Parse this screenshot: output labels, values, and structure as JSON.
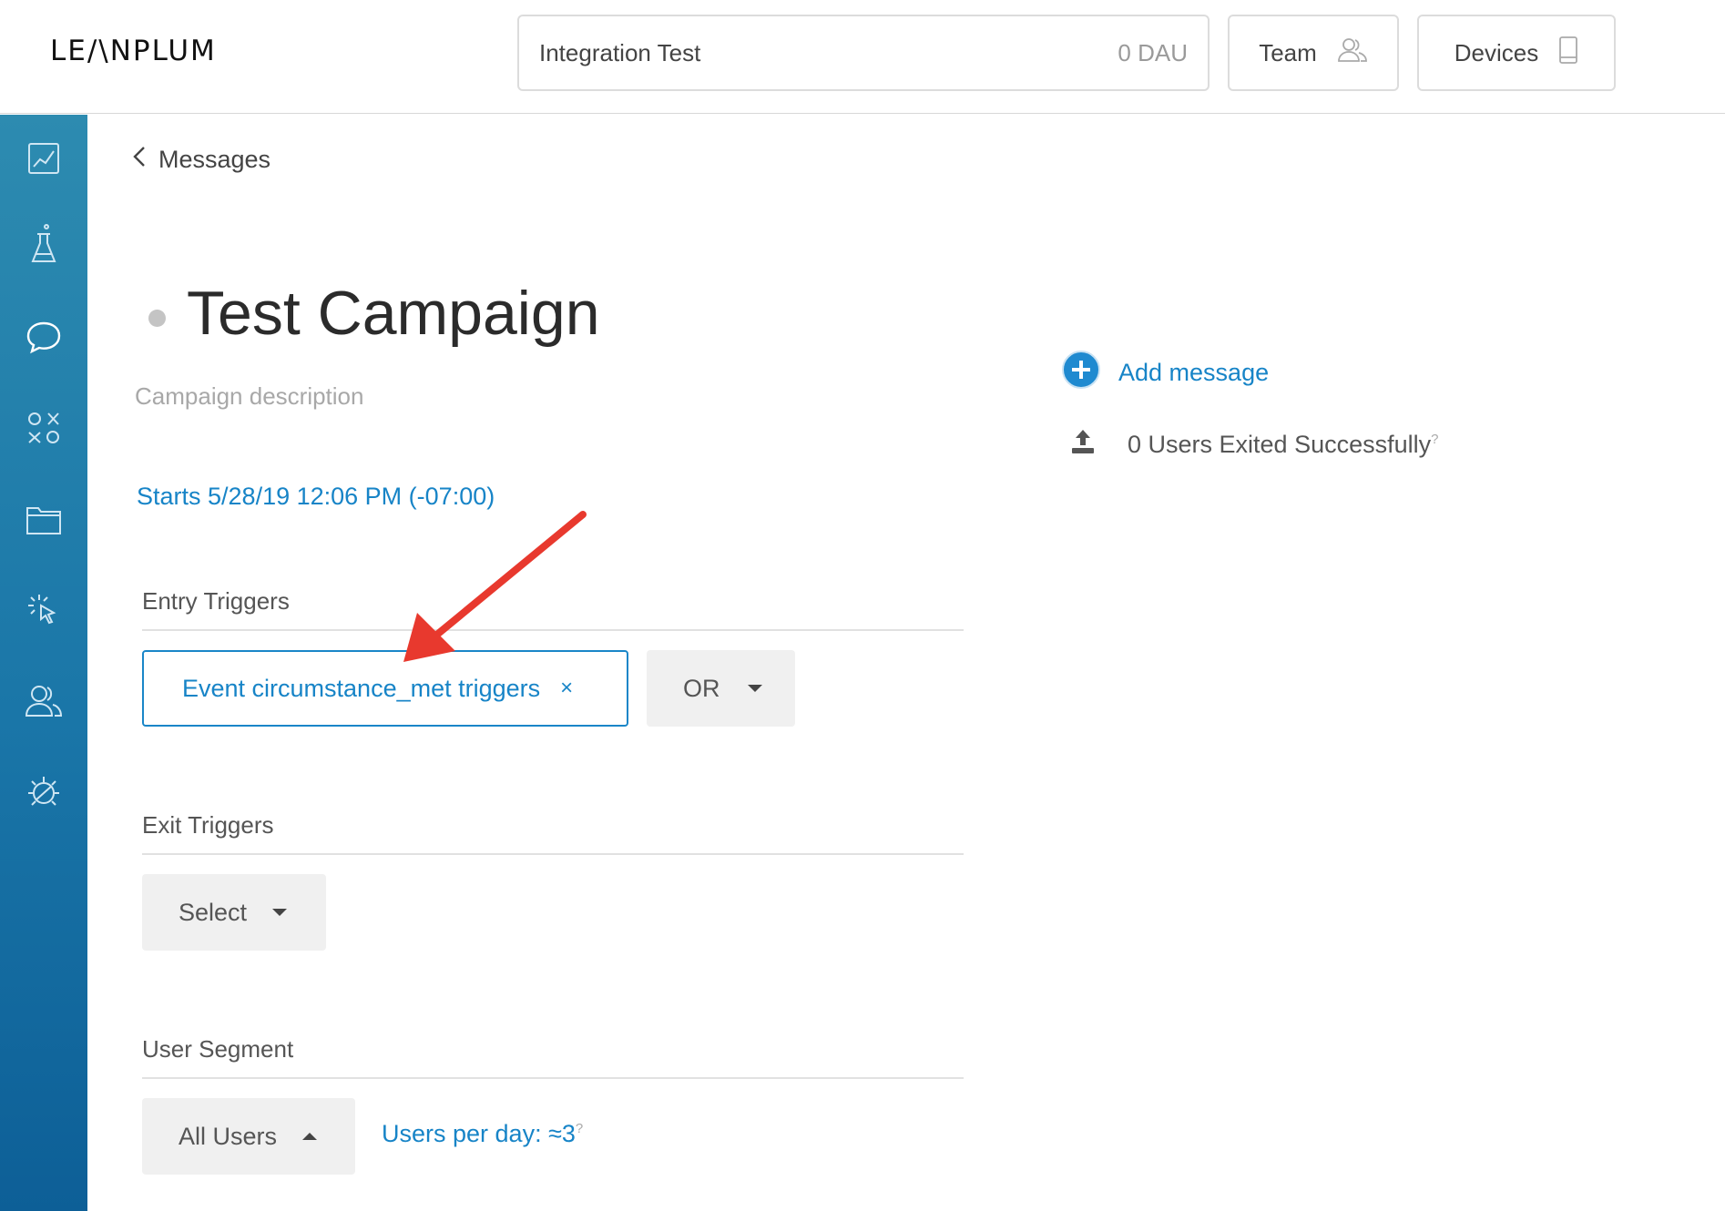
{
  "header": {
    "logo_text": "LE/\\NPLUM",
    "app_name": "Integration Test",
    "dau": "0 DAU",
    "team_label": "Team",
    "devices_label": "Devices"
  },
  "sidebar": {
    "items": [
      {
        "icon": "analytics-icon"
      },
      {
        "icon": "ab-test-flask-icon"
      },
      {
        "icon": "messages-chat-icon"
      },
      {
        "icon": "variables-icon"
      },
      {
        "icon": "folder-icon"
      },
      {
        "icon": "click-cursor-icon"
      },
      {
        "icon": "users-icon"
      },
      {
        "icon": "debug-bug-icon"
      }
    ],
    "accent": "#1a76a8"
  },
  "nav": {
    "back_label": "Messages"
  },
  "campaign": {
    "title": "Test Campaign",
    "description_placeholder": "Campaign description",
    "starts": "Starts 5/28/19 12:06 PM (-07:00)"
  },
  "entry_triggers": {
    "label": "Entry Triggers",
    "chip_label": "Event circumstance_met triggers",
    "chip_remove": "×",
    "operator": "OR"
  },
  "exit_triggers": {
    "label": "Exit Triggers",
    "select_label": "Select"
  },
  "user_segment": {
    "label": "User Segment",
    "segment": "All Users",
    "users_per_day": "Users per day: ≈3",
    "help_mark": "?"
  },
  "right": {
    "add_message": "Add message",
    "exited": "0 Users Exited Successfully",
    "help_mark": "?"
  },
  "colors": {
    "link": "#1784c7",
    "annotation_arrow": "#e8392e"
  }
}
